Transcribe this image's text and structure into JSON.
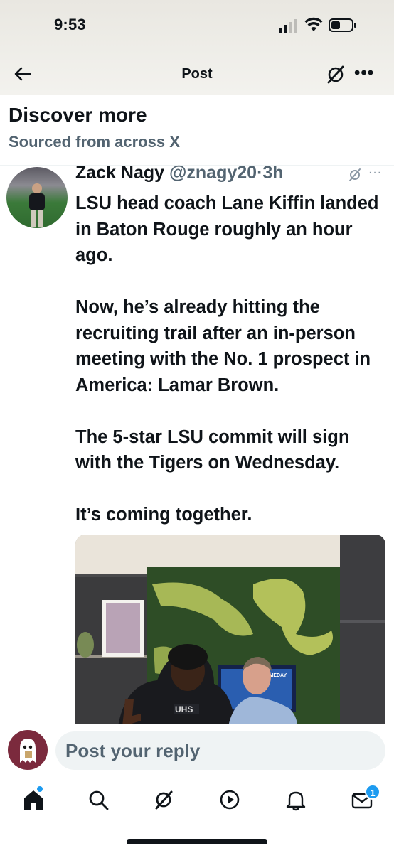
{
  "status_bar": {
    "time": "9:53"
  },
  "nav": {
    "title": "Post",
    "more": "•••"
  },
  "discover": {
    "title": "Discover more",
    "subtitle": "Sourced from across X"
  },
  "post": {
    "author_name": "Zack Nagy",
    "handle": "@znagy20",
    "separator": "·",
    "time": "3h",
    "more": "···",
    "text": "LSU head coach Lane Kiffin landed in Baton Rouge roughly an hour ago.\n\nNow, he’s already hitting the recruiting trail after an in-person meeting with the No. 1 prospect in America: Lamar Brown.\n\nThe 5-star LSU commit will sign with the Tigers on Wednesday.\n\nIt’s coming together.",
    "image_shirt_text": "UHS",
    "image_tv_text": "GAMEDAY"
  },
  "reply": {
    "placeholder": "Post your reply"
  },
  "tabbar": {
    "items": [
      "home-icon",
      "search-icon",
      "grok-icon",
      "video-icon",
      "notifications-icon",
      "messages-icon"
    ],
    "messages_badge": "1"
  },
  "colors": {
    "accent": "#1d9bf0",
    "secondary_text": "#536471",
    "text": "#0f1419"
  }
}
